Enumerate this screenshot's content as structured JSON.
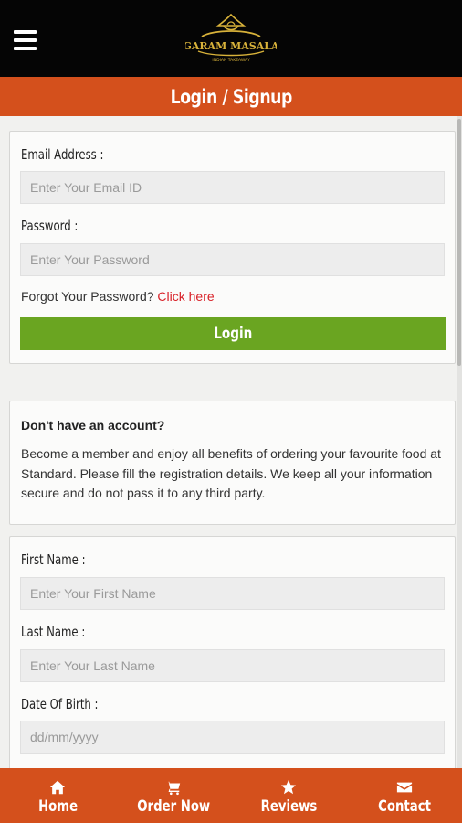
{
  "header": {
    "logo_text": "GARAM MASALA",
    "logo_tagline": "INDIAN TAKEAWAY"
  },
  "page": {
    "title": "Login / Signup"
  },
  "login": {
    "email_label": "Email Address :",
    "email_placeholder": "Enter Your Email ID",
    "password_label": "Password :",
    "password_placeholder": "Enter Your Password",
    "forgot_text": "Forgot Your Password?",
    "forgot_link": "Click here",
    "login_button": "Login"
  },
  "signup_info": {
    "title": "Don't have an account?",
    "text": "Become a member and enjoy all benefits of ordering your favourite food at Standard. Please fill the registration details. We keep all your information secure and do not pass it to any third party."
  },
  "register": {
    "first_name_label": "First Name :",
    "first_name_placeholder": "Enter Your First Name",
    "last_name_label": "Last Name :",
    "last_name_placeholder": "Enter Your Last Name",
    "dob_label": "Date Of Birth :",
    "dob_placeholder": "dd/mm/yyyy"
  },
  "bottom_nav": {
    "items": [
      {
        "label": "Home",
        "icon": "home-icon"
      },
      {
        "label": "Order Now",
        "icon": "cart-icon"
      },
      {
        "label": "Reviews",
        "icon": "star-icon"
      },
      {
        "label": "Contact",
        "icon": "envelope-icon"
      }
    ]
  },
  "colors": {
    "brand_orange": "#d4501c",
    "login_green": "#6aa521",
    "link_red": "#d81f26",
    "logo_gold": "#d8b23a"
  }
}
